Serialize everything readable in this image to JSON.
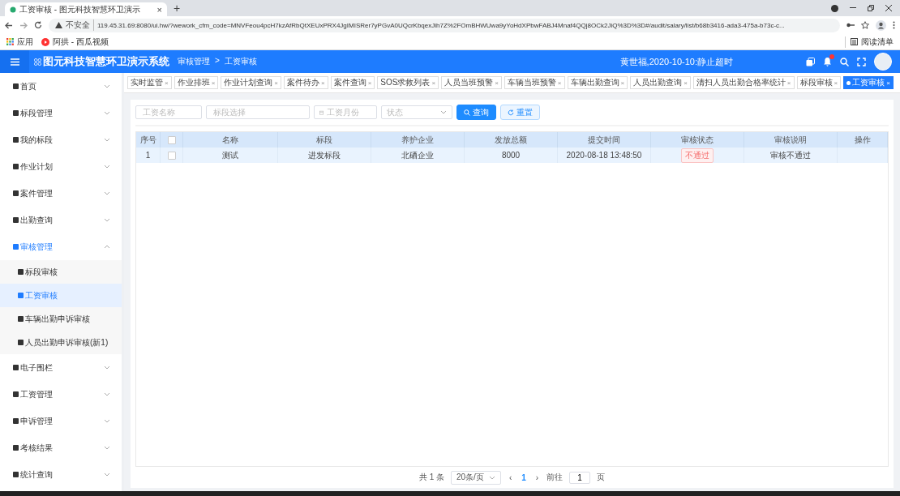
{
  "browser": {
    "tab_title": "工资审核 - 图元科技智慧环卫演示",
    "tab_close": "×",
    "new_tab": "+",
    "security_label": "不安全",
    "url": "119.45.31.69:8080/ui.hw/?wework_cfm_code=MNVFeou4pcH7kzAfRbQtXEUxPRX4JgIMISRer7yPGvA0UQcrKbqexJih7Z%2FOmBHWUwa9yYoHdXPbwFABJ4Mnaf4QQj8OCk2JiQ%3D%3D#/audit/salary/list/b68b3416-ada3-475a-b73c-c...",
    "bookmarks": [
      {
        "label": "应用",
        "kind": "apps"
      },
      {
        "label": "阿拱 - 西瓜视频",
        "kind": "video"
      }
    ],
    "reading_list": "阅读清单"
  },
  "header": {
    "title": "图元科技智慧环卫演示系统",
    "breadcrumb": [
      "审核管理",
      "工资审核"
    ],
    "breadcrumb_sep": ">",
    "notice": "黄世福,2020-10-10:静止超时",
    "has_notification": true
  },
  "sidebar": {
    "items": [
      {
        "label": "首页",
        "expanded": false
      },
      {
        "label": "标段管理",
        "expanded": false
      },
      {
        "label": "我的标段",
        "expanded": false
      },
      {
        "label": "作业计划",
        "expanded": false
      },
      {
        "label": "案件管理",
        "expanded": false
      },
      {
        "label": "出勤查询",
        "expanded": false
      },
      {
        "label": "审核管理",
        "expanded": true,
        "children": [
          {
            "label": "标段审核",
            "selected": false
          },
          {
            "label": "工资审核",
            "selected": true
          },
          {
            "label": "车辆出勤申诉审核",
            "selected": false
          },
          {
            "label": "人员出勤申诉审核(新1)",
            "selected": false
          }
        ]
      },
      {
        "label": "电子围栏",
        "expanded": false
      },
      {
        "label": "工资管理",
        "expanded": false
      },
      {
        "label": "申诉管理",
        "expanded": false
      },
      {
        "label": "考核结果",
        "expanded": false
      },
      {
        "label": "统计查询",
        "expanded": false
      }
    ]
  },
  "tags": [
    {
      "label": "实时监管",
      "selected": false
    },
    {
      "label": "作业排班",
      "selected": false
    },
    {
      "label": "作业计划查询",
      "selected": false
    },
    {
      "label": "案件待办",
      "selected": false
    },
    {
      "label": "案件查询",
      "selected": false
    },
    {
      "label": "SOS求救列表",
      "selected": false
    },
    {
      "label": "人员当班预警",
      "selected": false
    },
    {
      "label": "车辆当班预警",
      "selected": false
    },
    {
      "label": "车辆出勤查询",
      "selected": false
    },
    {
      "label": "人员出勤查询",
      "selected": false
    },
    {
      "label": "清扫人员出勤合格率统计",
      "selected": false
    },
    {
      "label": "标段审核",
      "selected": false
    },
    {
      "label": "工资审核",
      "selected": true
    }
  ],
  "tag_close": "×",
  "filters": {
    "name_placeholder": "工资名称",
    "section_placeholder": "标段选择",
    "month_placeholder": "工资月份",
    "status_placeholder": "状态",
    "search_button": "查询",
    "reset_button": "重置"
  },
  "table": {
    "columns": [
      {
        "kind": "text",
        "label": "序号"
      },
      {
        "kind": "checkbox",
        "checked": false
      },
      {
        "kind": "text",
        "label": "名称"
      },
      {
        "kind": "text",
        "label": "标段"
      },
      {
        "kind": "text",
        "label": "养护企业"
      },
      {
        "kind": "text",
        "label": "发放总额"
      },
      {
        "kind": "text",
        "label": "提交时间"
      },
      {
        "kind": "text",
        "label": "审核状态"
      },
      {
        "kind": "text",
        "label": "审核说明"
      },
      {
        "kind": "text",
        "label": "操作"
      }
    ],
    "rows": [
      {
        "selected": true,
        "cells": [
          {
            "kind": "text",
            "text": "1"
          },
          {
            "kind": "checkbox",
            "checked": false
          },
          {
            "kind": "text",
            "text": "测试"
          },
          {
            "kind": "text",
            "text": "进发标段"
          },
          {
            "kind": "text",
            "text": "北硒企业"
          },
          {
            "kind": "text",
            "text": "8000"
          },
          {
            "kind": "text",
            "text": "2020-08-18 13:48:50"
          },
          {
            "kind": "tag",
            "text": "不通过"
          },
          {
            "kind": "text",
            "text": "审核不通过"
          },
          {
            "kind": "empty"
          }
        ]
      }
    ]
  },
  "pagination": {
    "total": "共 1 条",
    "page_size": "20条/页",
    "prev": "‹",
    "pages": [
      {
        "label": "1",
        "selected": true
      }
    ],
    "next": "›",
    "goto_label": "前往",
    "goto_value": "1",
    "page_unit": "页"
  }
}
